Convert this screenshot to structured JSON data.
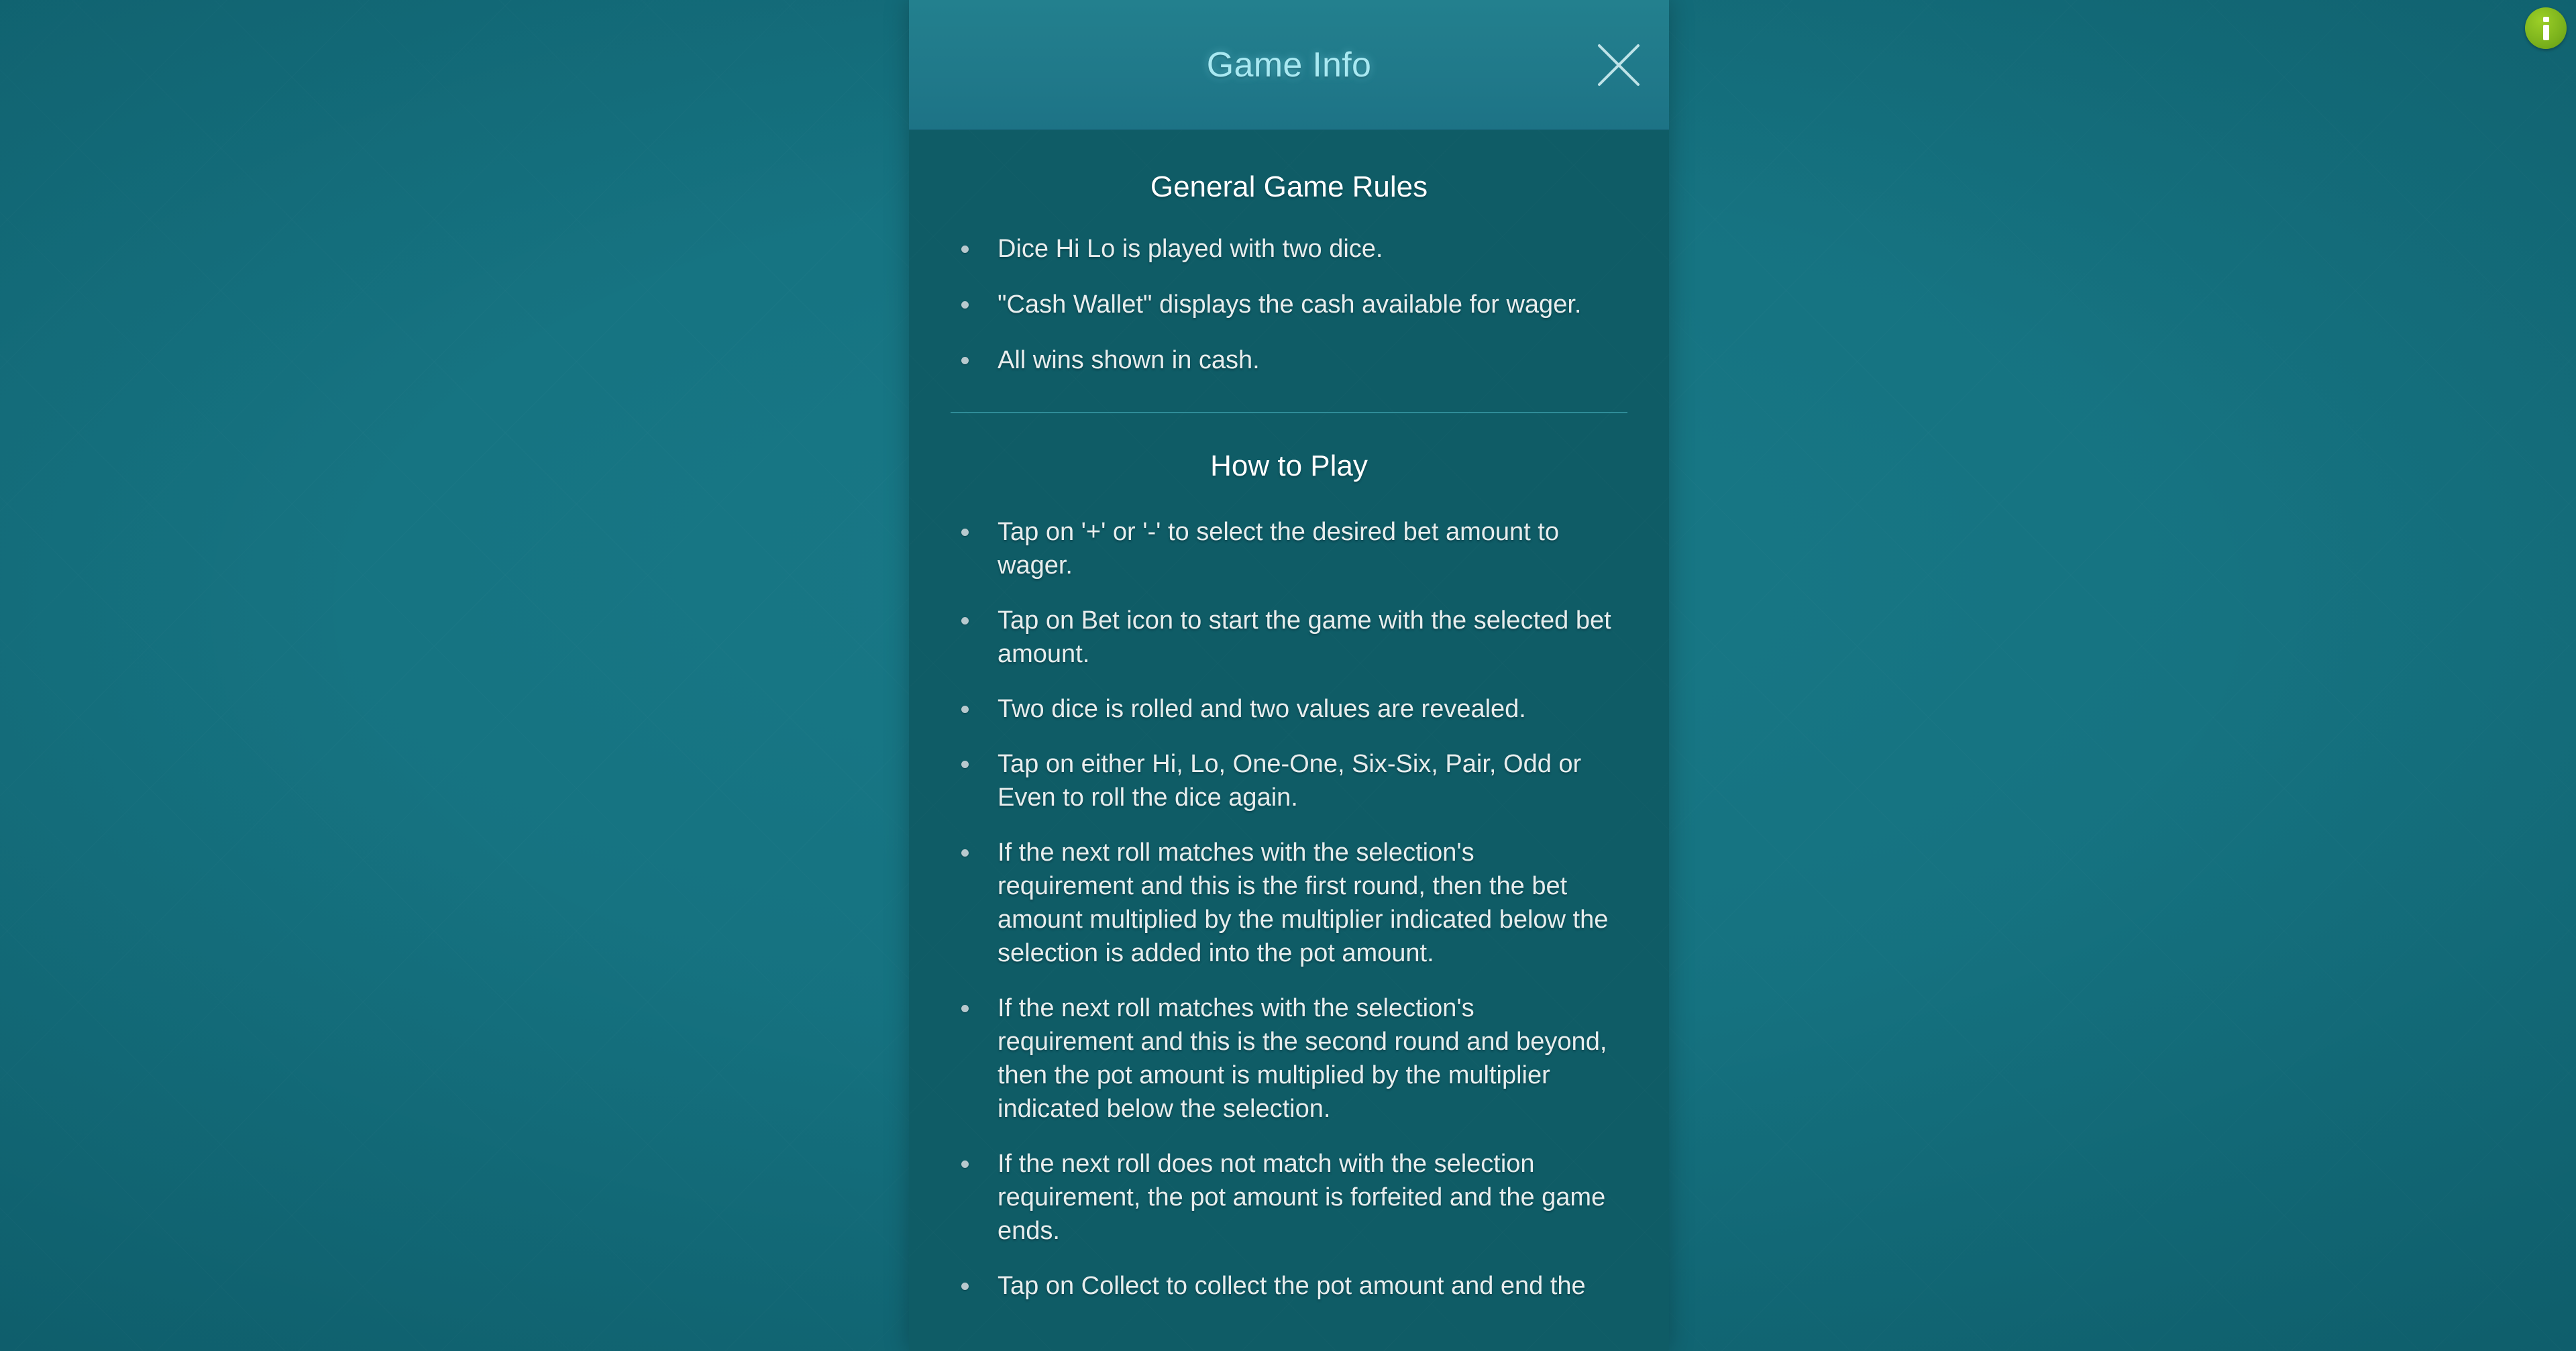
{
  "colors": {
    "backdrop": "#126c7a",
    "modal_body": "#0f5c66",
    "modal_header": "#20798a",
    "title_text": "#a9e9f2",
    "body_text": "#e7eded",
    "divider": "#2f8c98",
    "info_badge": "#7ab11c",
    "bullet": "#b8c9ce"
  },
  "info_badge": {
    "icon": "info-icon",
    "label": "i"
  },
  "modal": {
    "title": "Game Info",
    "close_icon": "close-icon",
    "sections": [
      {
        "id": "general-game-rules",
        "heading": "General Game Rules",
        "items": [
          "Dice Hi Lo is played with two dice.",
          "\"Cash Wallet\" displays the cash available for wager.",
          "All wins shown in cash."
        ]
      },
      {
        "id": "how-to-play",
        "heading": "How to Play",
        "items": [
          "Tap on '+' or '-' to select the desired bet amount to wager.",
          "Tap on Bet icon to start the game with the selected bet amount.",
          "Two dice is rolled and two values are revealed.",
          "Tap on either Hi, Lo, One-One, Six-Six, Pair, Odd or Even to roll the dice again.",
          "If the next roll matches with the selection's requirement and this is the first round, then the bet amount multiplied by the multiplier indicated below the selection is added into the pot amount.",
          "If the next roll matches with the selection's requirement and this is the second round and beyond, then the pot amount is multiplied by the multiplier indicated below the selection.",
          "If the next roll does not match with the selection requirement, the pot amount is forfeited and the game ends.",
          "Tap on Collect to collect the pot amount and end the"
        ]
      }
    ]
  }
}
